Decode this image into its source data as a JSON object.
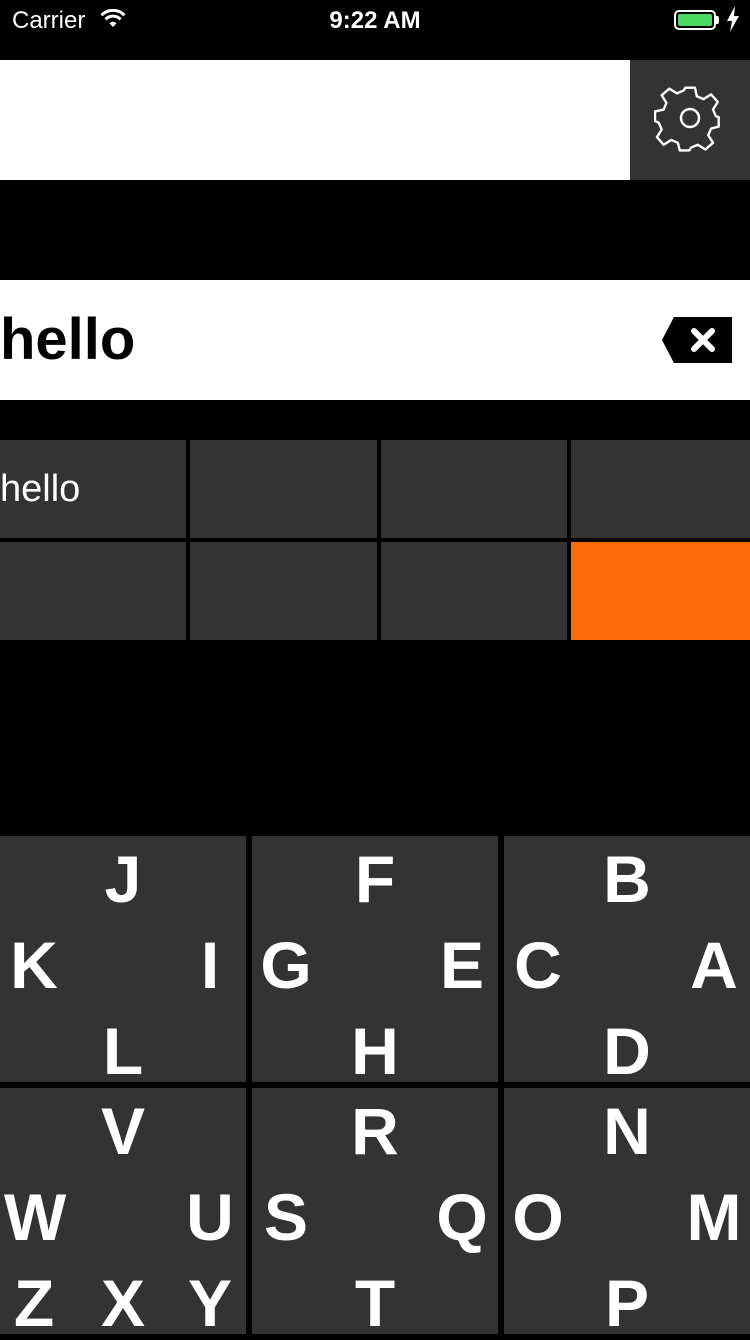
{
  "status_bar": {
    "carrier": "Carrier",
    "time": "9:22 AM"
  },
  "search": {
    "value": "",
    "placeholder": ""
  },
  "compose": {
    "text": "hello"
  },
  "suggestions": [
    "hello",
    "",
    "",
    "",
    "",
    "",
    "",
    ""
  ],
  "keyboard": {
    "keys": [
      {
        "top": "J",
        "left": "K",
        "right": "I",
        "bottom": "L"
      },
      {
        "top": "F",
        "left": "G",
        "right": "E",
        "bottom": "H"
      },
      {
        "top": "B",
        "left": "C",
        "right": "A",
        "bottom": "D"
      },
      {
        "top": "V",
        "left": "W",
        "right": "U",
        "bottom": "X",
        "bottom_left": "Z",
        "bottom_right": "Y"
      },
      {
        "top": "R",
        "left": "S",
        "right": "Q",
        "bottom": "T"
      },
      {
        "top": "N",
        "left": "O",
        "right": "M",
        "bottom": "P"
      }
    ]
  },
  "colors": {
    "accent": "#ff6b08",
    "cell": "#333333",
    "battery": "#4cd964"
  },
  "icons": [
    "wifi-icon",
    "battery-icon",
    "charging-bolt-icon",
    "gear-icon",
    "backspace-icon"
  ]
}
